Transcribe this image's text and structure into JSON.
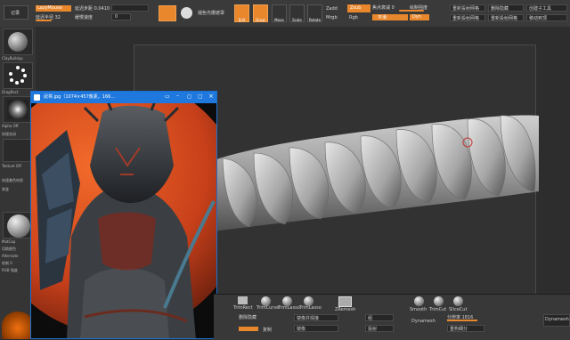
{
  "topbar": {
    "mode_button": "记录",
    "lazy_label": "LazyMouse",
    "slider_a_label": "延迟步距 0.0410",
    "slider_b_label": "延迟半径 32",
    "slider_c_label": "缓慢速度",
    "slider_d_label": "0",
    "transform_label": "褪色光栅遮罩",
    "btn_edit": "Edit",
    "btn_draw": "Draw",
    "btn_move": "Move",
    "btn_scale": "Scale",
    "btn_rotate": "Rotate",
    "zadd": "Zadd",
    "zsub": "Zsub",
    "mrgb": "Mrgb",
    "rgb": "Rgb",
    "focal_label": "焦点衰减 0",
    "draw_size_label": "绘制强度",
    "active_label": "平滑",
    "dyn_label": "Dyn",
    "right_label_1": "重新投射网格",
    "right_label_2": "删除隐藏",
    "right_label_3": "重新投射网格",
    "right_label_4": "创建子工具",
    "right_label_5": "重新投射网格",
    "right_label_6": "移动到顶"
  },
  "lefttray": {
    "label_brush": "ClayBuildup",
    "label_stroke": "DragRect",
    "label_alpha": "Alpha Off",
    "label_texture": "纹理关闭",
    "label_mat": "Texture Off",
    "label_mat2": "快速着色材质",
    "label_gradient": "渐变",
    "label_switch": "切换颜色",
    "label_alt": "Alternate",
    "label_dot": "绘制 0",
    "label_rgb": "RGB 强度",
    "label_matcap": "MatCap"
  },
  "viewer": {
    "title": "武将.jpg（1074×457像素，166..."
  },
  "bottombar": {
    "tool_1": "TrimRect",
    "tool_2": "TrimCurve",
    "tool_3": "TrimLasso",
    "tool_4": "TrimLasso",
    "tool_5": "ZRemesh",
    "label_a": "删除隐藏",
    "label_b": "复制",
    "label_c": "镜像并焊接",
    "label_d": "镜像",
    "label_e": "Dynamesh",
    "label_f": "分辨率 1816",
    "label_g": "重构细分",
    "label_h": "Smooth",
    "label_i": "TrimCut",
    "label_j": "SliceCut",
    "label_k": "Dynamesh",
    "label_l": "组",
    "label_m": "投射"
  }
}
